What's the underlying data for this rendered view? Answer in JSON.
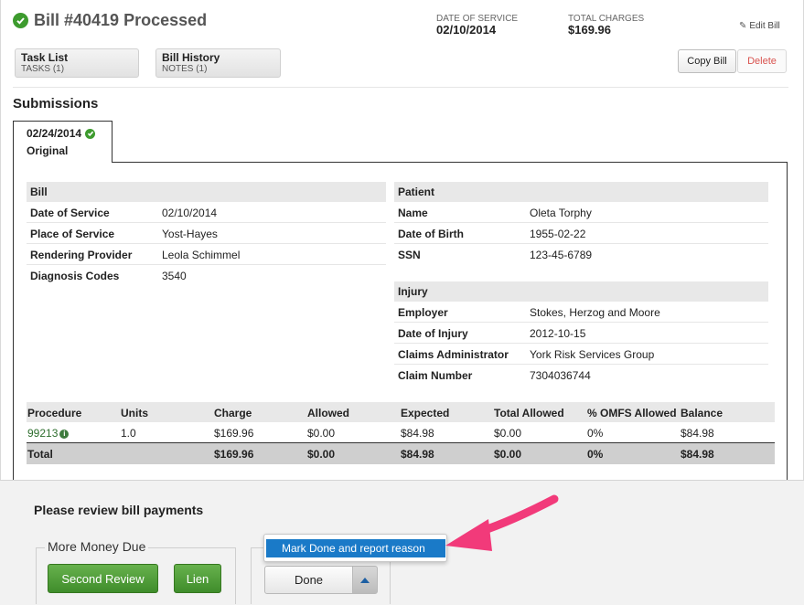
{
  "header": {
    "title": "Bill #40419 Processed",
    "date_of_service_label": "DATE OF SERVICE",
    "date_of_service": "02/10/2014",
    "total_charges_label": "TOTAL CHARGES",
    "total_charges": "$169.96",
    "edit_label": "Edit Bill"
  },
  "toolbar": {
    "task_list": {
      "title": "Task List",
      "sub": "TASKS (1)"
    },
    "bill_history": {
      "title": "Bill History",
      "sub": "NOTES (1)"
    },
    "copy_label": "Copy Bill",
    "delete_label": "Delete"
  },
  "submissions": {
    "heading": "Submissions",
    "tab": {
      "date": "02/24/2014",
      "type": "Original"
    }
  },
  "bill": {
    "heading": "Bill",
    "rows": [
      {
        "k": "Date of Service",
        "v": "02/10/2014"
      },
      {
        "k": "Place of Service",
        "v": "Yost-Hayes"
      },
      {
        "k": "Rendering Provider",
        "v": "Leola Schimmel"
      },
      {
        "k": "Diagnosis Codes",
        "v": "3540"
      }
    ]
  },
  "patient": {
    "heading": "Patient",
    "rows": [
      {
        "k": "Name",
        "v": "Oleta Torphy"
      },
      {
        "k": "Date of Birth",
        "v": "1955-02-22"
      },
      {
        "k": "SSN",
        "v": "123-45-6789"
      }
    ]
  },
  "injury": {
    "heading": "Injury",
    "rows": [
      {
        "k": "Employer",
        "v": "Stokes, Herzog and Moore"
      },
      {
        "k": "Date of Injury",
        "v": "2012-10-15"
      },
      {
        "k": "Claims Administrator",
        "v": "York Risk Services Group"
      },
      {
        "k": "Claim Number",
        "v": "7304036744"
      }
    ]
  },
  "procedures": {
    "headers": [
      "Procedure",
      "Units",
      "Charge",
      "Allowed",
      "Expected",
      "Total Allowed",
      "% OMFS Allowed",
      "Balance"
    ],
    "row": [
      "99213",
      "1.0",
      "$169.96",
      "$0.00",
      "$84.98",
      "$0.00",
      "0%",
      "$84.98"
    ],
    "total": [
      "Total",
      "",
      "$169.96",
      "$0.00",
      "$84.98",
      "$0.00",
      "0%",
      "$84.98"
    ]
  },
  "review": {
    "title": "Please review bill payments",
    "group_label": "More Money Due",
    "second_review_label": "Second Review",
    "lien_label": "Lien",
    "done_label": "Done",
    "menu_item": "Mark Done and report reason"
  },
  "colors": {
    "success_green": "#3d9b2e",
    "button_green": "#4f9e3a",
    "menu_blue": "#1a7ac8",
    "annotation_pink": "#f23a7a",
    "delete_red": "#d9534f"
  }
}
